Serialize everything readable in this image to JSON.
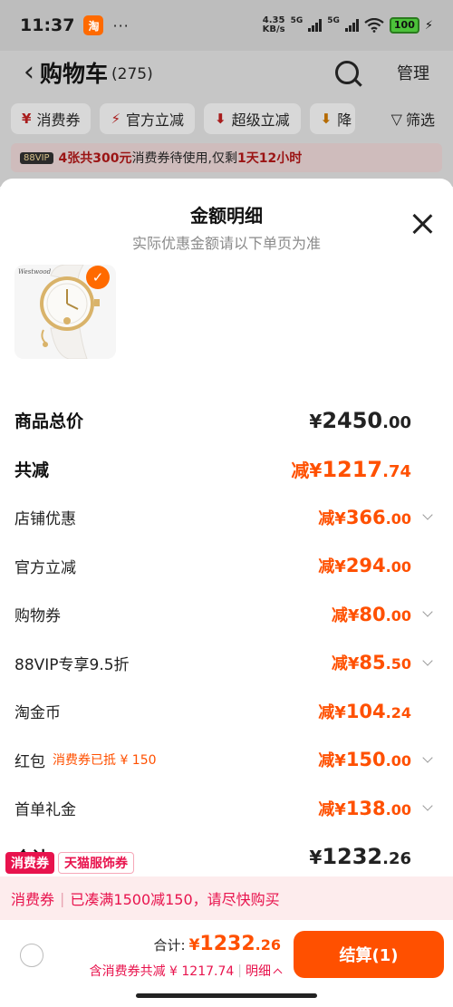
{
  "status_bar": {
    "time": "11:37",
    "app_icon_text": "淘",
    "more": "···",
    "speed_value": "4.35",
    "speed_unit": "KB/s",
    "sim1": "5G",
    "sim2": "5G",
    "battery": "100"
  },
  "nav": {
    "title": "购物车",
    "count": "(275)",
    "manage": "管理"
  },
  "filters": {
    "chips": [
      "消费券",
      "官方立减",
      "超级立减",
      "降"
    ],
    "filter_label": "筛选"
  },
  "notice": {
    "vip_tag": "88VIP",
    "highlight1": "4张共300元",
    "middle": "消费券待使用,仅剩",
    "highlight2": "1天12小时"
  },
  "sheet": {
    "title": "金额明细",
    "subtitle": "实际优惠金额请以下单页为准",
    "product_brand": "Westwood",
    "rows": [
      {
        "label": "商品总价",
        "prefix": "¥",
        "int": "2450",
        "dec": ".00",
        "style": "strong-black",
        "chevron": false
      },
      {
        "label": "共减",
        "prefix": "减¥",
        "int": "1217",
        "dec": ".74",
        "style": "strong",
        "chevron": false
      },
      {
        "label": "店铺优惠",
        "prefix": "减¥",
        "int": "366",
        "dec": ".00",
        "style": "normal",
        "chevron": true
      },
      {
        "label": "官方立减",
        "prefix": "减¥",
        "int": "294",
        "dec": ".00",
        "style": "normal",
        "chevron": false
      },
      {
        "label": "购物券",
        "prefix": "减¥",
        "int": "80",
        "dec": ".00",
        "style": "normal",
        "chevron": true
      },
      {
        "label": "88VIP专享9.5折",
        "prefix": "减¥",
        "int": "85",
        "dec": ".50",
        "style": "normal",
        "chevron": true
      },
      {
        "label": "淘金币",
        "prefix": "减¥",
        "int": "104",
        "dec": ".24",
        "style": "normal",
        "chevron": false
      },
      {
        "label": "红包",
        "note": "消费券已抵 ¥ 150",
        "prefix": "减¥",
        "int": "150",
        "dec": ".00",
        "style": "normal",
        "chevron": true
      },
      {
        "label": "首单礼金",
        "prefix": "减¥",
        "int": "138",
        "dec": ".00",
        "style": "normal",
        "chevron": true
      },
      {
        "label": "合计",
        "prefix": "¥",
        "int": "1232",
        "dec": ".26",
        "style": "strong-black",
        "chevron": false
      }
    ]
  },
  "coupon": {
    "tag1": "消费券",
    "tag2": "天猫服饰券",
    "bar_label": "消费券",
    "bar_text": "已凑满1500减150，请尽快购买"
  },
  "bottom": {
    "total_label": "合计:",
    "total_prefix": "¥",
    "total_int": "1232",
    "total_dec": ".26",
    "saved_text": "含消费券共减 ¥ 1217.74",
    "detail_label": "明细",
    "checkout_label": "结算(1)"
  },
  "colors": {
    "accent": "#ff5000",
    "coupon_red": "#e8134d"
  }
}
